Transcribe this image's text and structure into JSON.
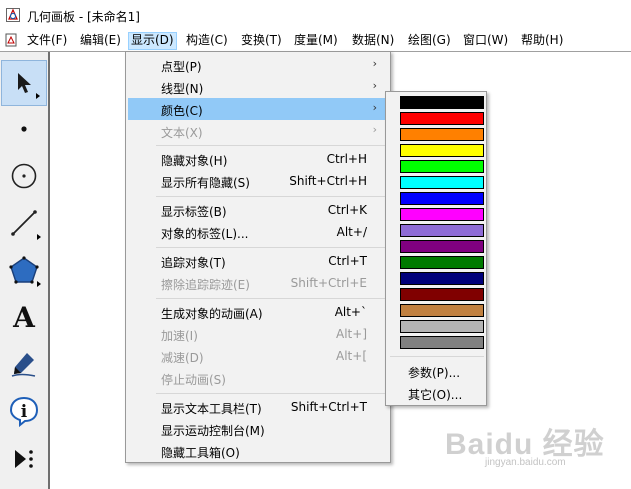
{
  "window": {
    "title": "几何画板 - [未命名1]"
  },
  "menubar": {
    "items": [
      {
        "label": "文件(F)"
      },
      {
        "label": "编辑(E)"
      },
      {
        "label": "显示(D)"
      },
      {
        "label": "构造(C)"
      },
      {
        "label": "变换(T)"
      },
      {
        "label": "度量(M)"
      },
      {
        "label": "数据(N)"
      },
      {
        "label": "绘图(G)"
      },
      {
        "label": "窗口(W)"
      },
      {
        "label": "帮助(H)"
      }
    ],
    "active": "显示(D)"
  },
  "toolbox": {
    "tools": [
      {
        "name": "arrow-tool",
        "selected": true
      },
      {
        "name": "point-tool"
      },
      {
        "name": "compass-tool"
      },
      {
        "name": "straightedge-tool"
      },
      {
        "name": "polygon-tool"
      },
      {
        "name": "text-tool",
        "glyph": "A"
      },
      {
        "name": "marker-tool"
      },
      {
        "name": "information-tool",
        "glyph": "i"
      },
      {
        "name": "custom-tool"
      }
    ]
  },
  "display_menu": {
    "items": [
      {
        "label": "点型(P)",
        "shortcut": "",
        "submenu": true,
        "enabled": true
      },
      {
        "label": "线型(N)",
        "shortcut": "",
        "submenu": true,
        "enabled": true
      },
      {
        "label": "颜色(C)",
        "shortcut": "",
        "submenu": true,
        "enabled": true,
        "highlighted": true
      },
      {
        "label": "文本(X)",
        "shortcut": "",
        "submenu": true,
        "enabled": false
      },
      {
        "label": "隐藏对象(H)",
        "shortcut": "Ctrl+H",
        "enabled": true
      },
      {
        "label": "显示所有隐藏(S)",
        "shortcut": "Shift+Ctrl+H",
        "enabled": true
      },
      {
        "label": "显示标签(B)",
        "shortcut": "Ctrl+K",
        "enabled": true
      },
      {
        "label": "对象的标签(L)...",
        "shortcut": "Alt+/",
        "enabled": true
      },
      {
        "label": "追踪对象(T)",
        "shortcut": "Ctrl+T",
        "enabled": true
      },
      {
        "label": "擦除追踪踪迹(E)",
        "shortcut": "Shift+Ctrl+E",
        "enabled": false
      },
      {
        "label": "生成对象的动画(A)",
        "shortcut": "Alt+`",
        "enabled": true
      },
      {
        "label": "加速(I)",
        "shortcut": "Alt+]",
        "enabled": false
      },
      {
        "label": "减速(D)",
        "shortcut": "Alt+[",
        "enabled": false
      },
      {
        "label": "停止动画(S)",
        "shortcut": "",
        "enabled": false
      },
      {
        "label": "显示文本工具栏(T)",
        "shortcut": "Shift+Ctrl+T",
        "enabled": true
      },
      {
        "label": "显示运动控制台(M)",
        "shortcut": "",
        "enabled": true
      },
      {
        "label": "隐藏工具箱(O)",
        "shortcut": "",
        "enabled": true
      }
    ]
  },
  "color_submenu": {
    "swatches": [
      "#000000",
      "#ff0000",
      "#ff8000",
      "#ffff00",
      "#00ff00",
      "#00ffff",
      "#0000ff",
      "#ff00ff",
      "#8e6bd6",
      "#800080",
      "#007a00",
      "#00007a",
      "#800000",
      "#c08040",
      "#b4b4b4",
      "#808080"
    ],
    "items": [
      {
        "label": "参数(P)..."
      },
      {
        "label": "其它(O)..."
      }
    ]
  },
  "watermark": {
    "brand": "Baidu 经验",
    "url": "jingyan.baidu.com"
  }
}
